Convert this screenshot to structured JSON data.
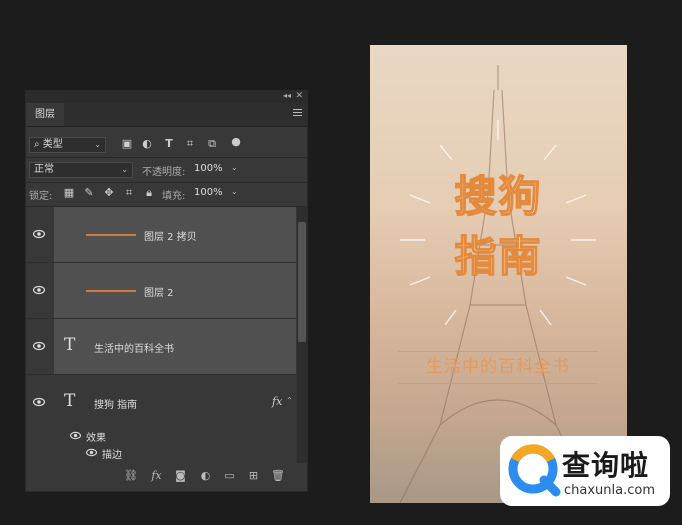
{
  "panel": {
    "collapse_glyph": "◂◂",
    "close_glyph": "✕",
    "tab_label": "图层",
    "filter": {
      "icon": "search-icon",
      "label": "类型"
    },
    "blend_mode": "正常",
    "opacity_label": "不透明度:",
    "opacity_value": "100%",
    "lock_label": "锁定:",
    "fill_label": "填充:",
    "fill_value": "100%"
  },
  "layers": [
    {
      "name": "图层 2 拷贝",
      "kind": "shape",
      "visible": true
    },
    {
      "name": "图层 2",
      "kind": "shape",
      "visible": true
    },
    {
      "name": "生活中的百科全书",
      "kind": "text",
      "visible": true
    },
    {
      "name": "搜狗 指南",
      "kind": "text",
      "visible": true,
      "fx": "fx",
      "effects_label": "效果",
      "effect_item": "描边"
    }
  ],
  "canvas": {
    "title_line1": "搜狗",
    "title_line2": "指南",
    "subtitle": "生活中的百科全书",
    "accent_color": "#e48a3c"
  },
  "watermark": {
    "cn": "查询啦",
    "en": "chaxunla.com"
  }
}
